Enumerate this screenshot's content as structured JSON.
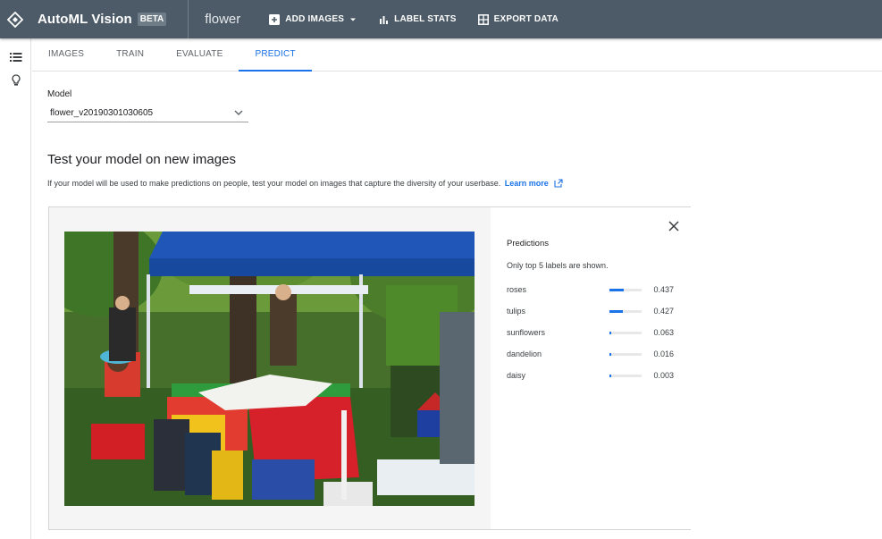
{
  "header": {
    "app_title": "AutoML Vision",
    "badge": "BETA",
    "dataset": "flower",
    "add_images": "ADD IMAGES",
    "label_stats": "LABEL STATS",
    "export_data": "EXPORT DATA"
  },
  "tabs": [
    "IMAGES",
    "TRAIN",
    "EVALUATE",
    "PREDICT"
  ],
  "active_tab": "PREDICT",
  "model": {
    "label": "Model",
    "selected": "flower_v20190301030605"
  },
  "test": {
    "heading": "Test your model on new images",
    "note": "If your model will be used to make predictions on people, test your model on images that capture the diversity of your userbase.",
    "link": "Learn more"
  },
  "predictions": {
    "title": "Predictions",
    "subtitle": "Only top 5 labels are shown.",
    "items": [
      {
        "label": "roses",
        "score": "0.437",
        "value": 0.437
      },
      {
        "label": "tulips",
        "score": "0.427",
        "value": 0.427
      },
      {
        "label": "sunflowers",
        "score": "0.063",
        "value": 0.063
      },
      {
        "label": "dandelion",
        "score": "0.016",
        "value": 0.016
      },
      {
        "label": "daisy",
        "score": "0.003",
        "value": 0.003
      }
    ]
  },
  "colors": {
    "topbar": "#4c5b67",
    "accent": "#1a73e8"
  },
  "icons": {
    "logo": "automl-diamond-icon",
    "add": "add-box-icon",
    "stats": "bar-chart-icon",
    "export": "table-grid-icon",
    "list": "list-icon",
    "bulb": "lightbulb-icon",
    "close": "close-icon",
    "external": "open-in-new-icon"
  }
}
